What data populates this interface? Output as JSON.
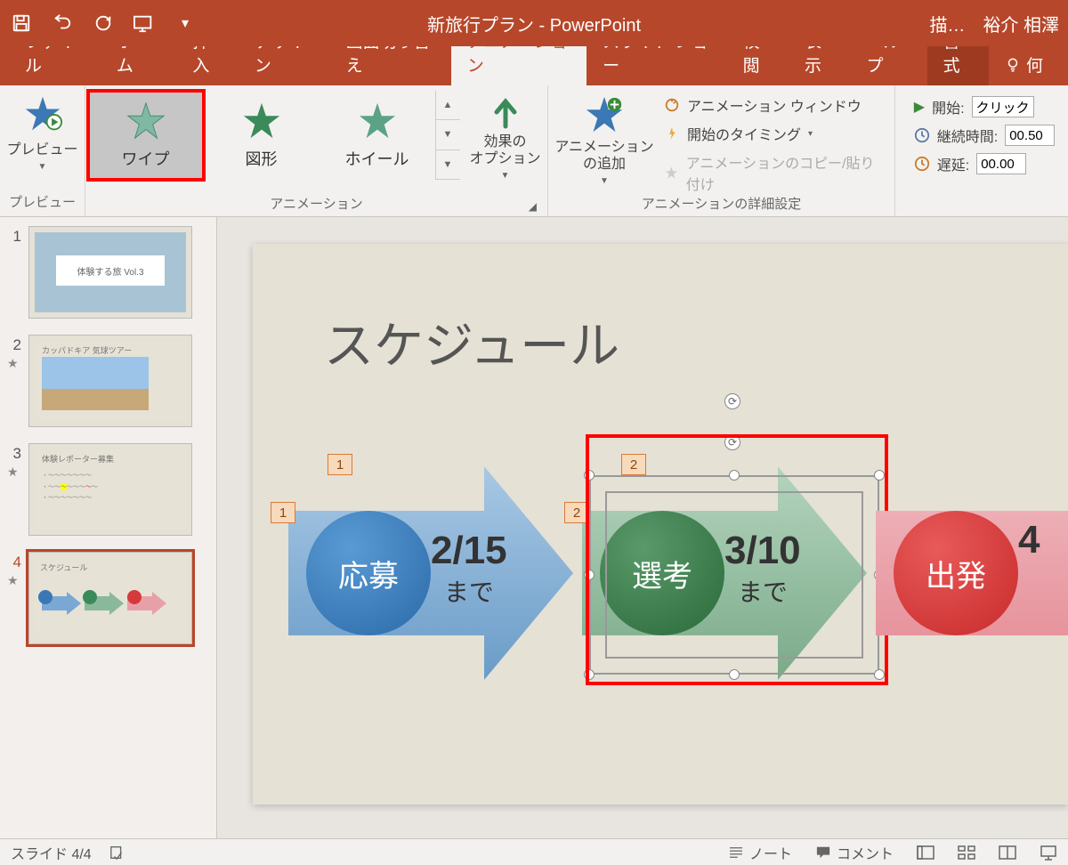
{
  "titlebar": {
    "doc_title": "新旅行プラン - PowerPoint",
    "draw_label": "描…",
    "user_name": "裕介 相澤"
  },
  "tabs": {
    "file": "ファイル",
    "home": "ホーム",
    "insert": "挿入",
    "design": "デザイン",
    "transitions": "画面切り替え",
    "animations": "アニメーション",
    "slideshow": "スライド ショー",
    "review": "校閲",
    "view": "表示",
    "help": "ヘルプ",
    "format": "書式",
    "tell_me": "何"
  },
  "ribbon": {
    "preview_label": "プレビュー",
    "preview_group": "プレビュー",
    "animation_group": "アニメーション",
    "gallery": {
      "wipe": "ワイプ",
      "shape": "図形",
      "wheel": "ホイール"
    },
    "effect_options": "効果の\nオプション",
    "add_animation": "アニメーション\nの追加",
    "adv": {
      "pane": "アニメーション ウィンドウ",
      "trigger": "開始のタイミング",
      "painter": "アニメーションのコピー/貼り付け",
      "group": "アニメーションの詳細設定"
    },
    "timing": {
      "start_label": "開始:",
      "start_value": "クリック時",
      "duration_label": "継続時間:",
      "duration_value": "00.50",
      "delay_label": "遅延:",
      "delay_value": "00.00"
    }
  },
  "thumbs": {
    "n1": "1",
    "n2": "2",
    "n3": "3",
    "n4": "4",
    "t1_title": "体験する旅 Vol.3",
    "t2_title": "カッパドキア 気球ツアー",
    "t3_title": "体験レポーター募集",
    "t4_title": "スケジュール"
  },
  "slide": {
    "title": "スケジュール",
    "tag1a": "1",
    "tag1b": "1",
    "tag2a": "2",
    "tag2b": "2",
    "circle1": "応募",
    "date1_top": "2/15",
    "date1_bot": "まで",
    "circle2": "選考",
    "date2_top": "3/10",
    "date2_bot": "まで",
    "circle3": "出発",
    "date3_top": "4"
  },
  "status": {
    "slide_pos": "スライド 4/4",
    "notes": "ノート",
    "comments": "コメント"
  }
}
